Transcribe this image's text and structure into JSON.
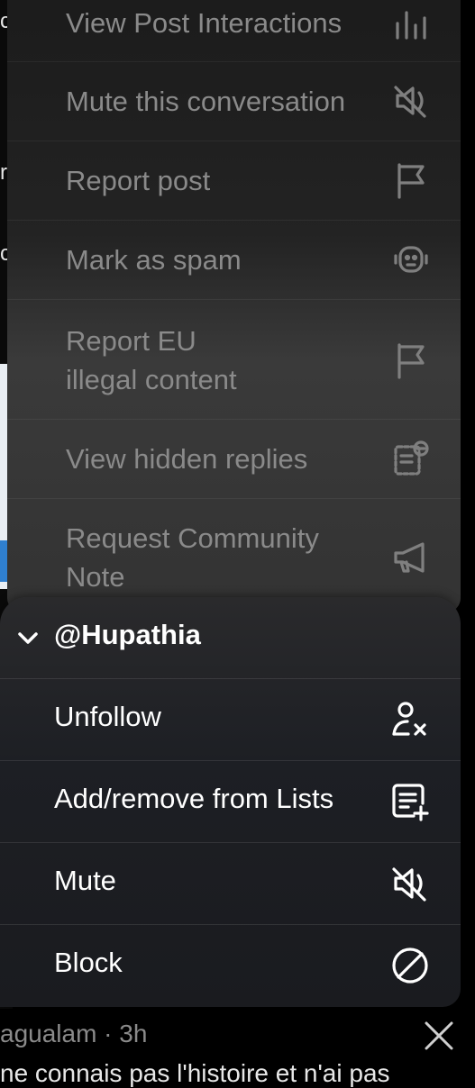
{
  "menu_top": {
    "items": [
      {
        "label": "View Post Interactions",
        "icon": "bar-chart-icon"
      },
      {
        "label": "Mute this conversation",
        "icon": "mute-speaker-icon"
      },
      {
        "label": "Report post",
        "icon": "flag-icon"
      },
      {
        "label": "Mark as spam",
        "icon": "robot-icon"
      },
      {
        "label_line1": "Report EU",
        "label_line2": "illegal content",
        "icon": "flag-icon"
      },
      {
        "label": "View hidden replies",
        "icon": "hidden-replies-icon"
      },
      {
        "label_line1": "Request Community",
        "label_line2": "Note",
        "icon": "megaphone-icon"
      }
    ]
  },
  "user_sheet": {
    "handle": "@Hupathia",
    "items": [
      {
        "label": "Unfollow",
        "icon": "unfollow-icon"
      },
      {
        "label": "Add/remove from Lists",
        "icon": "add-list-icon"
      },
      {
        "label": "Mute",
        "icon": "mute-speaker-icon"
      },
      {
        "label": "Block",
        "icon": "block-icon"
      }
    ]
  },
  "background_tweet": {
    "meta": "agualam · 3h",
    "text": "ne connais pas l'histoire et n'ai pas"
  }
}
